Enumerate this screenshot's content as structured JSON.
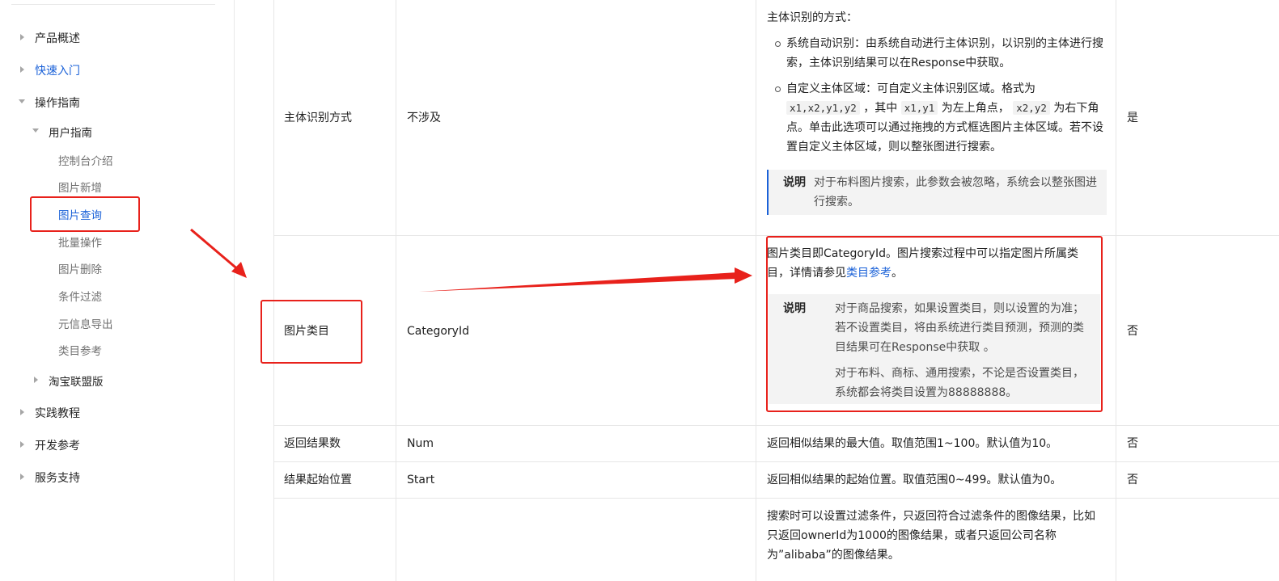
{
  "sidebar": {
    "items": {
      "product_overview": "产品概述",
      "quick_start": "快速入门",
      "operation_guide": "操作指南",
      "user_guide": "用户指南",
      "console_intro": "控制台介绍",
      "image_add": "图片新增",
      "image_query": "图片查询",
      "batch_ops": "批量操作",
      "image_delete": "图片删除",
      "condition_filter": "条件过滤",
      "meta_export": "元信息导出",
      "category_ref": "类目参考",
      "taobao_union": "淘宝联盟版",
      "practice_tutorial": "实践教程",
      "dev_ref": "开发参考",
      "service_support": "服务支持"
    }
  },
  "table": {
    "row1": {
      "name": "主体识别方式",
      "param": "不涉及",
      "desc_title": "主体识别的方式：",
      "bullet1": "系统自动识别：由系统自动进行主体识别，以识别的主体进行搜索，主体识别结果可以在Response中获取。",
      "bullet2_a": "自定义主体区域：可自定义主体识别区域。格式为",
      "code1": "x1,x2,y1,y2",
      "bullet2_b": "，其中",
      "code2": "x1,y1",
      "bullet2_c": "为左上角点，",
      "code3": "x2,y2",
      "bullet2_d": "为右下角点。单击此选项可以通过拖拽的方式框选图片主体区域。若不设置自定义主体区域，则以整张图进行搜索。",
      "note_label": "说明",
      "note_text": "对于布料图片搜索，此参数会被忽略，系统会以整张图进行搜索。",
      "required": "是"
    },
    "row2": {
      "name": "图片类目",
      "param": "CategoryId",
      "desc_a": "图片类目即CategoryId。图片搜索过程中可以指定图片所属类目，详情请参见",
      "desc_link": "类目参考",
      "desc_b": "。",
      "note_label": "说明",
      "note_bullet1": "对于商品搜索，如果设置类目，则以设置的为准；若不设置类目，将由系统进行类目预测，预测的类目结果可在Response中获取 。",
      "note_bullet2": "对于布料、商标、通用搜索，不论是否设置类目，系统都会将类目设置为88888888。",
      "required": "否"
    },
    "row3": {
      "name": "返回结果数",
      "param": "Num",
      "desc": "返回相似结果的最大值。取值范围1~100。默认值为10。",
      "required": "否"
    },
    "row4": {
      "name": "结果起始位置",
      "param": "Start",
      "desc": "返回相似结果的起始位置。取值范围0~499。默认值为0。",
      "required": "否"
    },
    "row5": {
      "desc": "搜索时可以设置过滤条件，只返回符合过滤条件的图像结果，比如只返回ownerId为1000的图像结果，或者只返回公司名称为”alibaba”的图像结果。"
    }
  },
  "colors": {
    "accent": "#1a61d8",
    "annotation": "#e8211b"
  }
}
